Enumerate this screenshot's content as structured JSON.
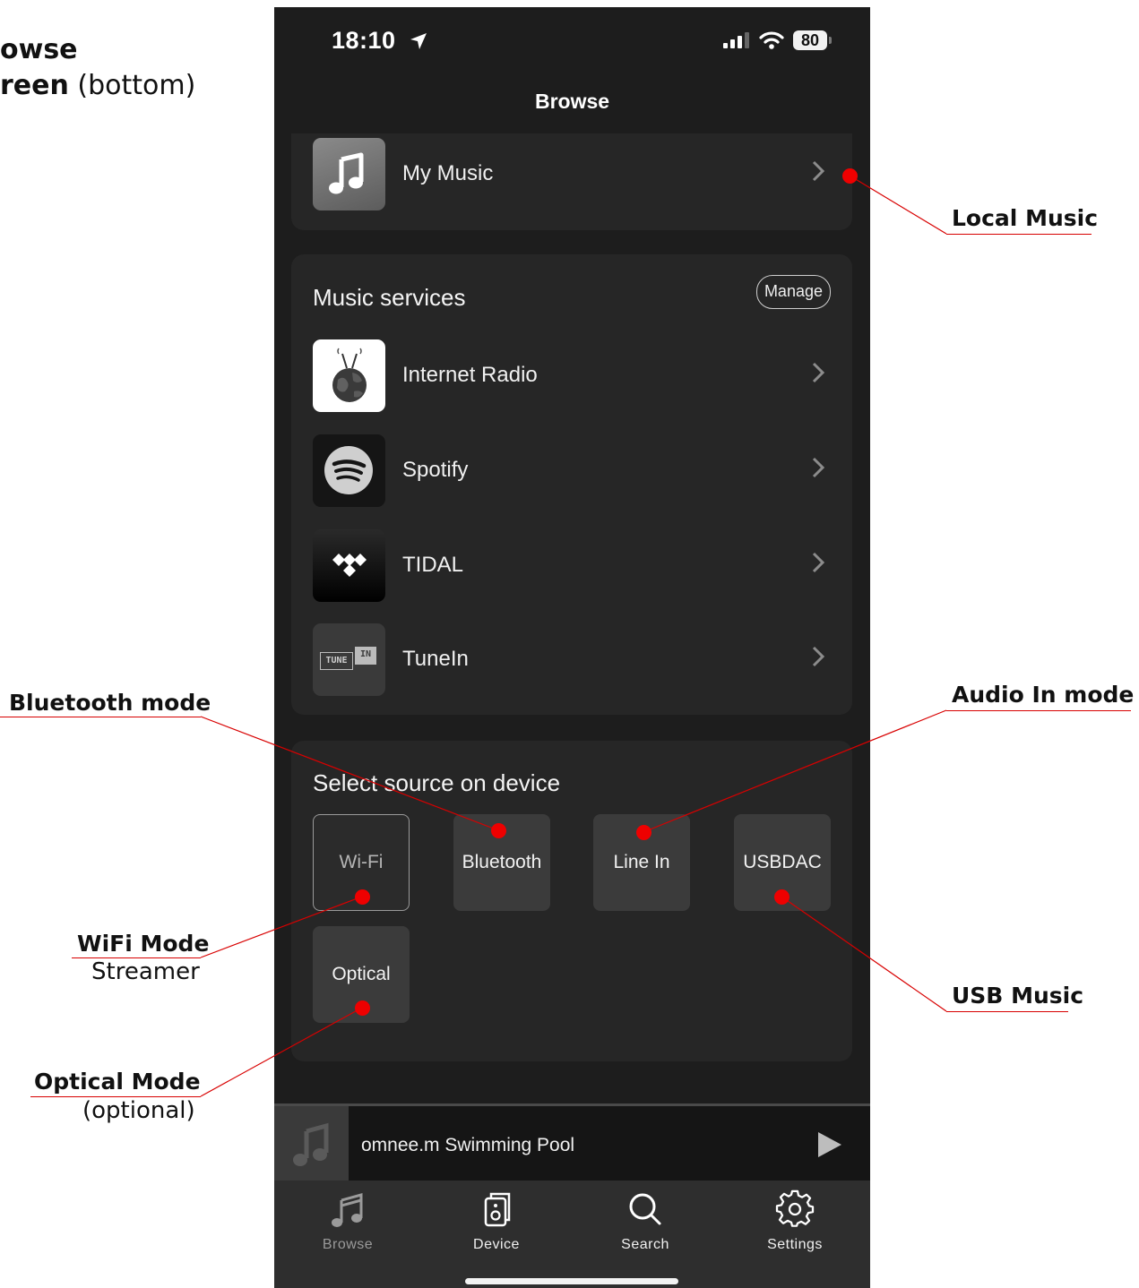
{
  "annotations": {
    "top_left_line1": "owse",
    "top_left_line2_bold": "reen",
    "top_left_line2_rest": " (bottom)",
    "local_music": "Local Music",
    "bluetooth_mode": "Bluetooth mode",
    "audio_in_mode": "Audio In mode",
    "wifi_mode": "WiFi Mode",
    "wifi_sub": "Streamer",
    "usb_music": "USB Music",
    "optical_mode": "Optical Mode",
    "optical_sub": "(optional)",
    "line_color": "#d80000",
    "dot_color": "#ee0000"
  },
  "status_bar": {
    "time": "18:10",
    "battery": "80"
  },
  "nav": {
    "title": "Browse"
  },
  "my_music": {
    "label": "My Music"
  },
  "music_services": {
    "title": "Music services",
    "manage_label": "Manage",
    "items": [
      {
        "label": "Internet Radio",
        "icon": "internet-radio-icon"
      },
      {
        "label": "Spotify",
        "icon": "spotify-icon"
      },
      {
        "label": "TIDAL",
        "icon": "tidal-icon"
      },
      {
        "label": "TuneIn",
        "icon": "tunein-icon"
      }
    ],
    "tunein_logo_left": "TUNE",
    "tunein_logo_right": "IN"
  },
  "sources": {
    "title": "Select source on device",
    "buttons": [
      "Wi-Fi",
      "Bluetooth",
      "Line In",
      "USBDAC",
      "Optical"
    ],
    "selected": "Wi-Fi"
  },
  "now_playing": {
    "title": "omnee.m Swimming Pool"
  },
  "tabs": [
    {
      "label": "Browse",
      "icon": "music-note-icon",
      "active": false
    },
    {
      "label": "Device",
      "icon": "speaker-icon",
      "active": true
    },
    {
      "label": "Search",
      "icon": "search-icon",
      "active": true
    },
    {
      "label": "Settings",
      "icon": "gear-icon",
      "active": true
    }
  ],
  "colors": {
    "screen_bg": "#1d1d1d",
    "card_bg": "#262626",
    "button_bg": "#3b3b3b",
    "tabbar_bg": "#2e2e2e"
  }
}
